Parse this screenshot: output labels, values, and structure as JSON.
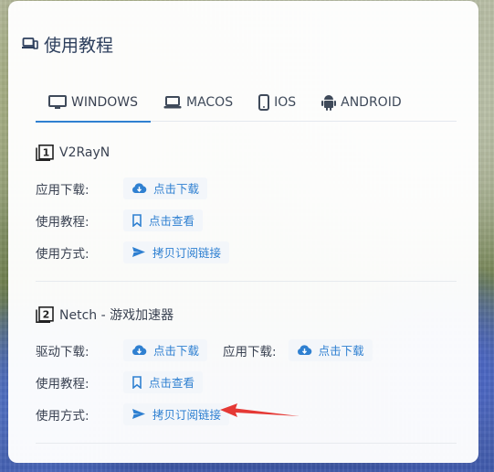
{
  "card": {
    "title": "使用教程"
  },
  "tabs": [
    {
      "label": "WINDOWS",
      "icon": "monitor-icon",
      "active": true
    },
    {
      "label": "MACOS",
      "icon": "laptop-icon",
      "active": false
    },
    {
      "label": "IOS",
      "icon": "phone-icon",
      "active": false
    },
    {
      "label": "ANDROID",
      "icon": "android-icon",
      "active": false
    }
  ],
  "sections": [
    {
      "number": "1",
      "title": "V2RayN",
      "rows": [
        {
          "label": "应用下载:",
          "action": "点击下载",
          "icon": "cloud-download-icon"
        },
        {
          "label": "使用教程:",
          "action": "点击查看",
          "icon": "bookmark-icon"
        },
        {
          "label": "使用方式:",
          "action": "拷贝订阅链接",
          "icon": "send-icon"
        }
      ]
    },
    {
      "number": "2",
      "title": "Netch - 游戏加速器",
      "rows": [
        {
          "label": "驱动下载:",
          "action": "点击下载",
          "icon": "cloud-download-icon",
          "label2": "应用下载:",
          "action2": "点击下载"
        },
        {
          "label": "使用教程:",
          "action": "点击查看",
          "icon": "bookmark-icon"
        },
        {
          "label": "使用方式:",
          "action": "拷贝订阅链接",
          "icon": "send-icon"
        }
      ]
    }
  ],
  "colors": {
    "accent": "#2f80d1",
    "annotation_arrow": "#e53935"
  }
}
